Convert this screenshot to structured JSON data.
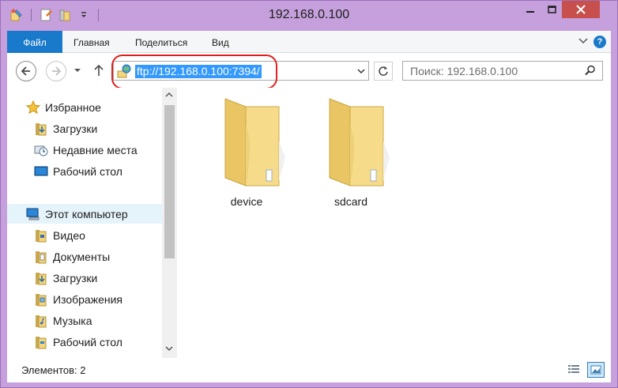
{
  "window": {
    "title": "192.168.0.100"
  },
  "ribbon": {
    "tabs": [
      "Файл",
      "Главная",
      "Поделиться",
      "Вид"
    ]
  },
  "navbar": {
    "address": "ftp://192.168.0.100:7394/",
    "search_placeholder": "Поиск: 192.168.0.100"
  },
  "sidebar": {
    "favorites": {
      "label": "Избранное",
      "items": [
        {
          "label": "Загрузки",
          "icon": "downloads-folder-icon"
        },
        {
          "label": "Недавние места",
          "icon": "recent-places-icon"
        },
        {
          "label": "Рабочий стол",
          "icon": "desktop-icon"
        }
      ]
    },
    "computer": {
      "label": "Этот компьютер",
      "items": [
        {
          "label": "Видео",
          "icon": "video-folder-icon"
        },
        {
          "label": "Документы",
          "icon": "documents-folder-icon"
        },
        {
          "label": "Загрузки",
          "icon": "downloads-folder-icon"
        },
        {
          "label": "Изображения",
          "icon": "pictures-folder-icon"
        },
        {
          "label": "Музыка",
          "icon": "music-folder-icon"
        },
        {
          "label": "Рабочий стол",
          "icon": "desktop-folder-icon"
        }
      ]
    }
  },
  "files": [
    {
      "name": "device",
      "type": "folder"
    },
    {
      "name": "sdcard",
      "type": "folder"
    }
  ],
  "status": {
    "items_count": "Элементов: 2"
  },
  "colors": {
    "window_frame": "#c5a0dc",
    "accent": "#1979ca",
    "selection": "#3399ff",
    "highlight_ring": "#e0201e",
    "close_button": "#c7504c",
    "folder": "#f3d57c"
  }
}
